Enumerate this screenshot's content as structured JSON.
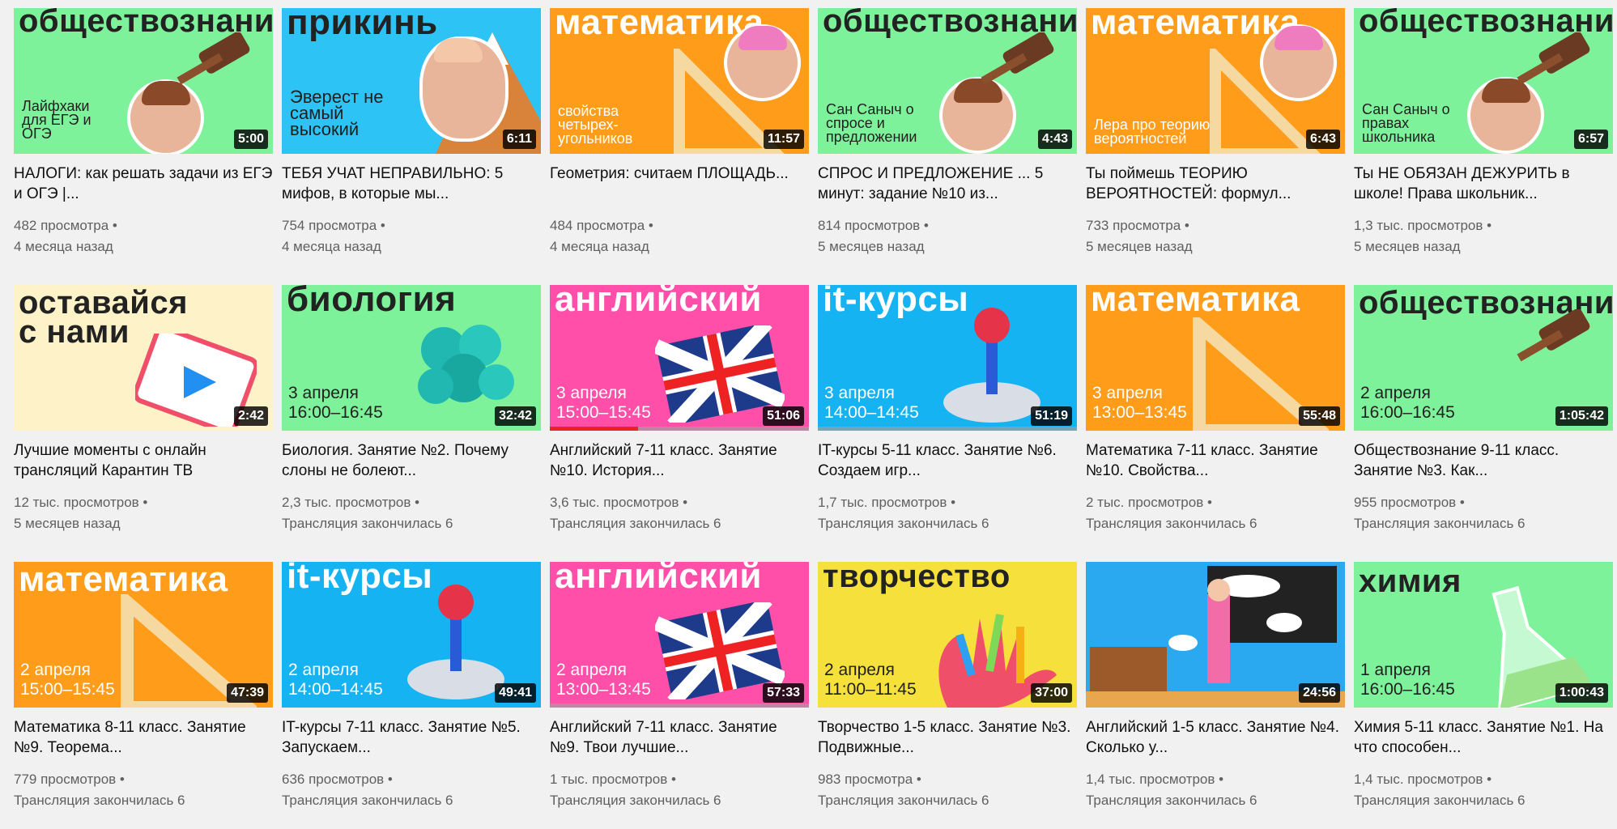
{
  "rows": [
    [
      {
        "subject": "обществознание",
        "subtitle": "Лайфхаки для ЕГЭ и ОГЭ",
        "duration": "5:00",
        "title": "НАЛОГИ: как решать задачи из ЕГЭ и ОГЭ |...",
        "views": "482 просмотра •",
        "age": "4 месяца назад",
        "bg": "#7ef29b"
      },
      {
        "subject": "прикинь",
        "subtitle": "Эверест не самый высокий",
        "duration": "6:11",
        "title": "ТЕБЯ УЧАТ НЕПРАВИЛЬНО: 5 мифов, в которые мы...",
        "views": "754 просмотра •",
        "age": "4 месяца назад",
        "bg": "#2ec3f5"
      },
      {
        "subject": "математика",
        "subtitle": "свойства четырех-угольников",
        "duration": "11:57",
        "title": "Геометрия: считаем ПЛОЩАДЬ...",
        "views": "484 просмотра •",
        "age": "4 месяца назад",
        "bg": "#ff9c1a"
      },
      {
        "subject": "обществознание",
        "subtitle": "Сан Саныч о спросе и предложении",
        "duration": "4:43",
        "title": "СПРОС И ПРЕДЛОЖЕНИЕ ... 5 минут: задание №10 из...",
        "views": "814 просмотров •",
        "age": "5 месяцев назад",
        "bg": "#7ef29b"
      },
      {
        "subject": "математика",
        "subtitle": "Лера про теорию вероятностей",
        "duration": "6:43",
        "title": "Ты поймешь ТЕОРИЮ ВЕРОЯТНОСТЕЙ: формул...",
        "views": "733 просмотра •",
        "age": "5 месяцев назад",
        "bg": "#ff9c1a"
      },
      {
        "subject": "обществознание",
        "subtitle": "Сан Саныч о правах школьника",
        "duration": "6:57",
        "title": "Ты НЕ ОБЯЗАН ДЕЖУРИТЬ в школе! Права школьник...",
        "views": "1,3 тыс. просмотров •",
        "age": "5 месяцев назад",
        "bg": "#7ef29b"
      }
    ],
    [
      {
        "subject": "оставайся с нами",
        "subtitle": "",
        "duration": "2:42",
        "title": "Лучшие моменты с онлайн трансляций Карантин ТВ",
        "views": "12 тыс. просмотров •",
        "age": "5 месяцев назад",
        "bg": "#fdf2c8"
      },
      {
        "subject": "биология",
        "subtitle": "3 апреля 16:00–16:45",
        "duration": "32:42",
        "title": "Биология. Занятие №2. Почему слоны не болеют...",
        "views": "2,3 тыс. просмотров •",
        "age": "Трансляция закончилась 6",
        "bg": "#7ef29b"
      },
      {
        "subject": "английский",
        "subtitle": "3 апреля 15:00–15:45",
        "duration": "51:06",
        "title": "Английский 7-11 класс. Занятие №10. История...",
        "views": "3,6 тыс. просмотров •",
        "age": "Трансляция закончилась 6",
        "bg": "#ff4fa8"
      },
      {
        "subject": "it-курсы",
        "subtitle": "3 апреля 14:00–14:45",
        "duration": "51:19",
        "title": "IT-курсы 5-11 класс. Занятие №6. Создаем игр...",
        "views": "1,7 тыс. просмотров •",
        "age": "Трансляция закончилась 6",
        "bg": "#16b3f2"
      },
      {
        "subject": "математика",
        "subtitle": "3 апреля 13:00–13:45",
        "duration": "55:48",
        "title": "Математика 7-11 класс. Занятие №10. Свойства...",
        "views": "2 тыс. просмотров •",
        "age": "Трансляция закончилась 6",
        "bg": "#ff9c1a"
      },
      {
        "subject": "обществознание",
        "subtitle": "2 апреля 16:00–16:45",
        "duration": "1:05:42",
        "title": "Обществознание 9-11 класс. Занятие №3. Как...",
        "views": "955 просмотров •",
        "age": "Трансляция закончилась 6",
        "bg": "#7ef29b"
      }
    ],
    [
      {
        "subject": "математика",
        "subtitle": "2 апреля 15:00–15:45",
        "duration": "47:39",
        "title": "Математика 8-11 класс. Занятие №9. Теорема...",
        "views": "779 просмотров •",
        "age": "Трансляция закончилась 6",
        "bg": "#ff9c1a"
      },
      {
        "subject": "it-курсы",
        "subtitle": "2 апреля 14:00–14:45",
        "duration": "49:41",
        "title": "IT-курсы 7-11 класс. Занятие №5. Запускаем...",
        "views": "636 просмотров •",
        "age": "Трансляция закончилась 6",
        "bg": "#16b3f2"
      },
      {
        "subject": "английский",
        "subtitle": "2 апреля 13:00–13:45",
        "duration": "57:33",
        "title": "Английский 7-11 класс. Занятие №9. Твои лучшие...",
        "views": "1 тыс. просмотров •",
        "age": "Трансляция закончилась 6",
        "bg": "#ff4fa8"
      },
      {
        "subject": "творчество",
        "subtitle": "2 апреля 11:00–11:45",
        "duration": "37:00",
        "title": "Творчество 1-5 класс. Занятие №3. Подвижные...",
        "views": "983 просмотра •",
        "age": "Трансляция закончилась 6",
        "bg": "#f6e03c"
      },
      {
        "subject": "",
        "subtitle": "",
        "duration": "24:56",
        "title": "Английский 1-5 класс. Занятие №4. Сколько у...",
        "views": "1,4 тыс. просмотров •",
        "age": "Трансляция закончилась 6",
        "bg": "#2ba9f0"
      },
      {
        "subject": "химия",
        "subtitle": "1 апреля 16:00–16:45",
        "duration": "1:00:43",
        "title": "Химия 5-11 класс. Занятие №1. На что способен...",
        "views": "1,4 тыс. просмотров •",
        "age": "Трансляция закончилась 6",
        "bg": "#7ef29b"
      }
    ]
  ]
}
